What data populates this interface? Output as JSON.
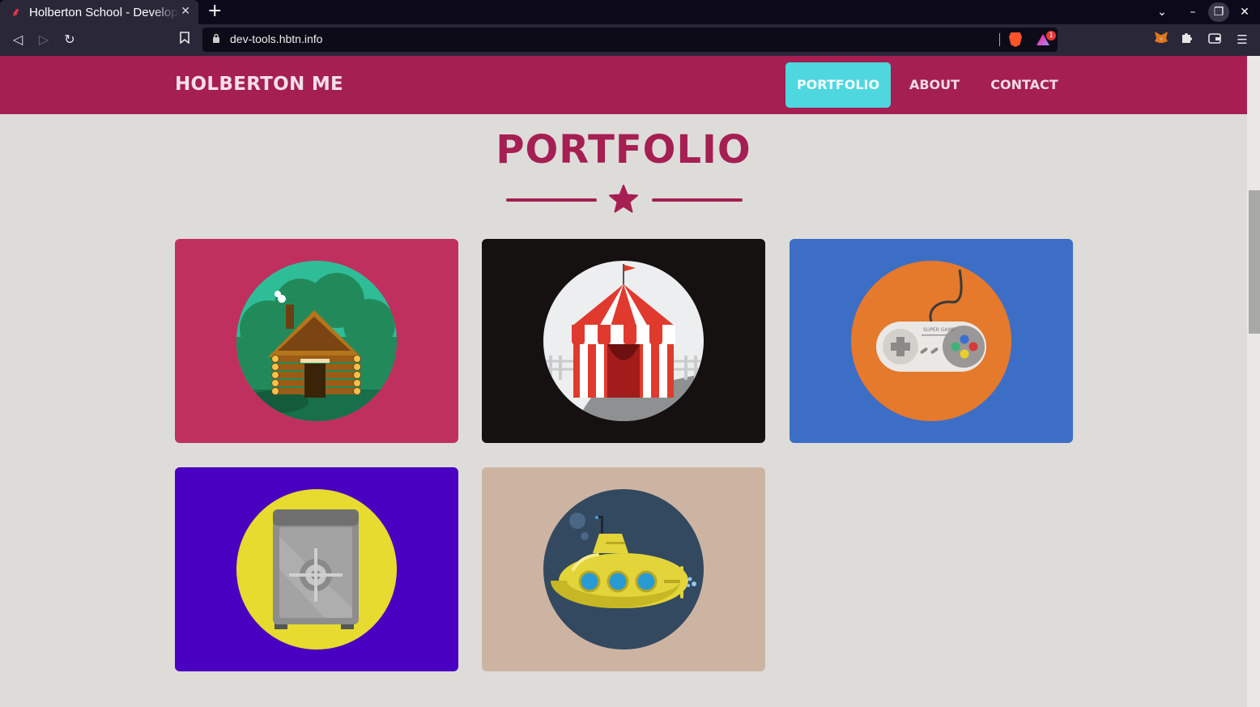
{
  "browser": {
    "tab_title": "Holberton School - Developer tools",
    "url": "dev-tools.hbtn.info",
    "rewards_badge": "1"
  },
  "site": {
    "brand": "HOLBERTON ME",
    "nav": [
      {
        "label": "PORTFOLIO",
        "active": true
      },
      {
        "label": "ABOUT",
        "active": false
      },
      {
        "label": "CONTACT",
        "active": false
      }
    ]
  },
  "portfolio": {
    "title": "PORTFOLIO",
    "items": [
      {
        "name": "cabin",
        "bg": "#c0305f"
      },
      {
        "name": "circus-tent",
        "bg": "#141110"
      },
      {
        "name": "game-controller",
        "bg": "#3d6ec6",
        "controller_text": "SUPER GAME"
      },
      {
        "name": "safe",
        "bg": "#4a00c0"
      },
      {
        "name": "submarine",
        "bg": "#cdb4a2"
      }
    ]
  },
  "colors": {
    "accent": "#a51f53",
    "active_nav": "#4fd7df",
    "page_bg": "#dddcd9"
  }
}
